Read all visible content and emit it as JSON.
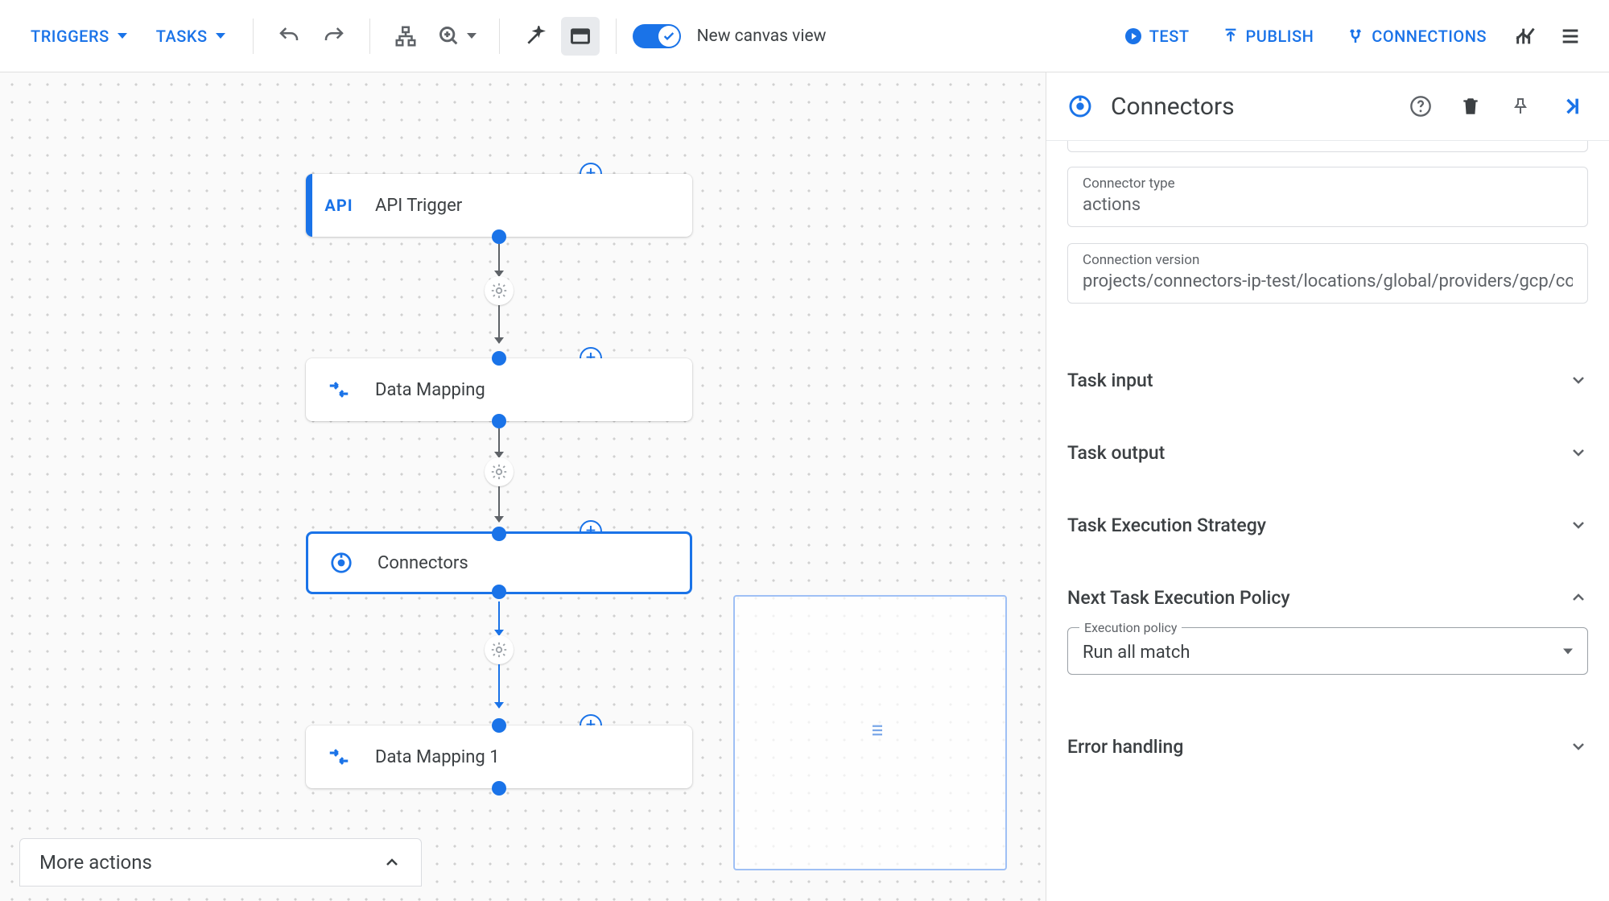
{
  "toolbar": {
    "triggers_label": "TRIGGERS",
    "tasks_label": "TASKS",
    "toggle_label": "New canvas view",
    "test_label": "TEST",
    "publish_label": "PUBLISH",
    "connections_label": "CONNECTIONS"
  },
  "canvas": {
    "nodes": {
      "api_trigger": {
        "icon_text": "API",
        "label": "API Trigger"
      },
      "data_mapping": {
        "label": "Data Mapping"
      },
      "connectors": {
        "label": "Connectors"
      },
      "data_mapping_1": {
        "label": "Data Mapping 1"
      }
    },
    "more_actions_label": "More actions"
  },
  "panel": {
    "title": "Connectors",
    "connector_type": {
      "label": "Connector type",
      "value": "actions"
    },
    "connection_version": {
      "label": "Connection version",
      "value": "projects/connectors-ip-test/locations/global/providers/gcp/co"
    },
    "sections": {
      "task_input": "Task input",
      "task_output": "Task output",
      "task_exec_strategy": "Task Execution Strategy",
      "next_task_policy": "Next Task Execution Policy",
      "error_handling": "Error handling"
    },
    "execution_policy": {
      "label": "Execution policy",
      "value": "Run all match"
    }
  }
}
